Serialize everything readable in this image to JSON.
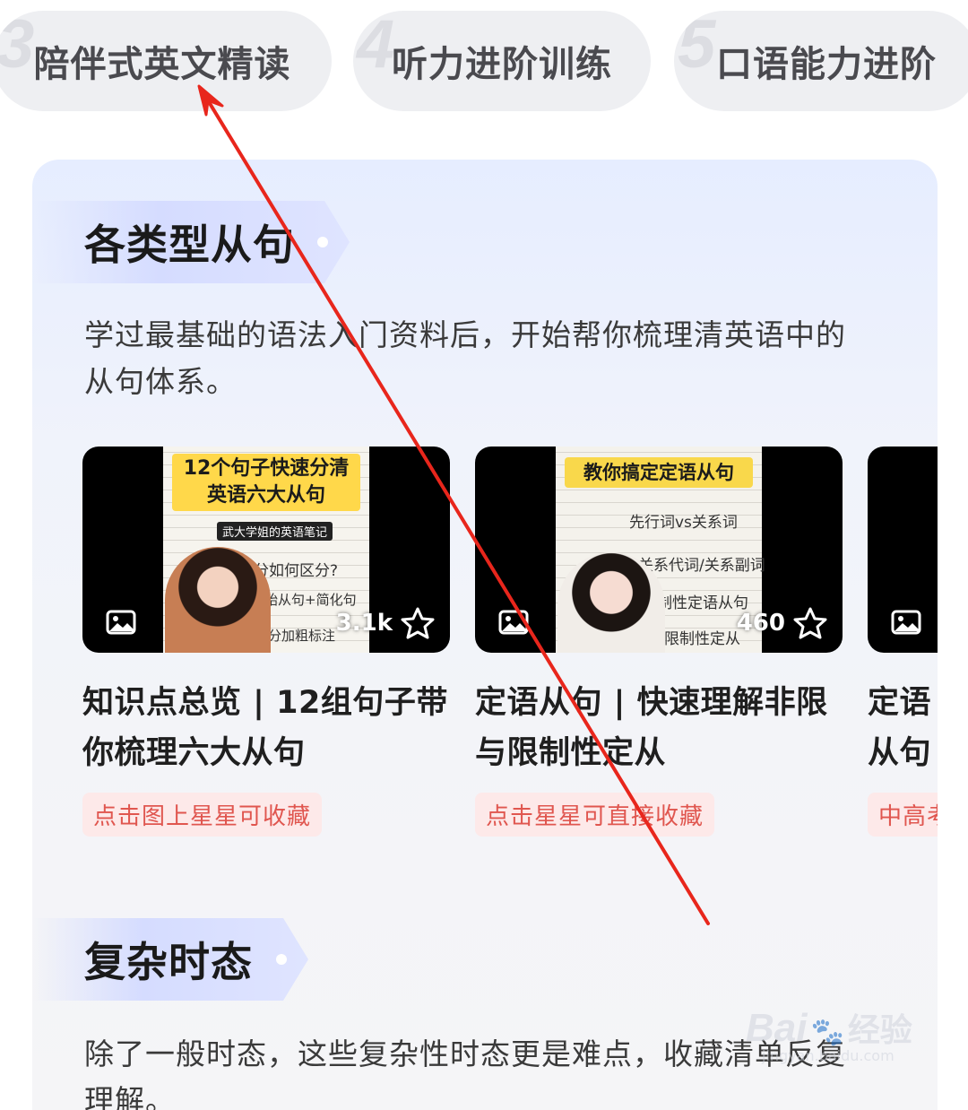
{
  "tabs": [
    {
      "number": "3",
      "label": "陪伴式英文精读"
    },
    {
      "number": "4",
      "label": "听力进阶训练"
    },
    {
      "number": "5",
      "label": "口语能力进阶"
    }
  ],
  "section1": {
    "title": "各类型从句",
    "description": "学过最基础的语法入门资料后，开始帮你梳理清英语中的从句体系。"
  },
  "videos": [
    {
      "thumb_headline": "12个句子快速分清英语六大从句",
      "thumb_notes": [
        "武大学姐的英语笔记",
        "句子成分如何区分?",
        "原始从句+简化句",
        "对应成分加粗标注"
      ],
      "count": "3.1k",
      "title": "知识点总览 | 12组句子带你梳理六大从句",
      "tag": "点击图上星星可收藏"
    },
    {
      "thumb_headline": "教你搞定定语从句",
      "thumb_notes": [
        "先行词vs关系词",
        "关系代词/关系副词",
        "限制性定语从句",
        "非限制性定从"
      ],
      "count": "460",
      "title": "定语从句 | 快速理解非限与限制性定从",
      "tag": "点击星星可直接收藏"
    },
    {
      "title": "定语从句定从",
      "tag": "中高考"
    }
  ],
  "section2": {
    "title": "复杂时态",
    "description": "除了一般时态，这些复杂性时态更是难点，收藏清单反复理解。"
  },
  "icons": {
    "image": "image-icon",
    "star": "star-outline-icon"
  },
  "colors": {
    "tag_bg": "#fde9e9",
    "tag_text": "#e0564f",
    "arrow": "#e8261c"
  },
  "watermark": {
    "brand": "Bai",
    "brand2": "经验",
    "url": "jingyan.baidu.com"
  }
}
